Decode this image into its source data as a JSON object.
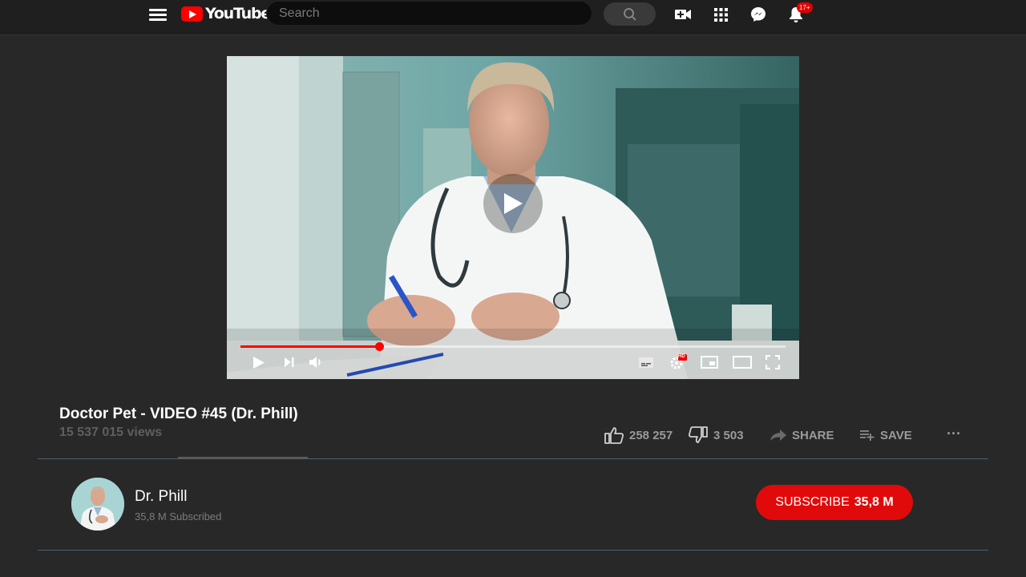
{
  "header": {
    "logo_text": "YouTube",
    "search_placeholder": "Search",
    "notification_count": "17+"
  },
  "player": {
    "progress_fraction": 0.255,
    "hd_label": "HD"
  },
  "video": {
    "title": "Doctor Pet - VIDEO #45 (Dr. Phill)",
    "views": "15 537 015 views",
    "likes": "258 257",
    "dislikes": "3 503",
    "share_label": "SHARE",
    "save_label": "SAVE",
    "more_label": "···"
  },
  "channel": {
    "name": "Dr. Phill",
    "subscribers": "35,8 M Subscribed",
    "subscribe_label": "SUBSCRIBE",
    "subscribe_count": "35,8 M"
  },
  "colors": {
    "accent": "#ff0000",
    "background": "#282828",
    "topbar": "#1f1f1f"
  }
}
